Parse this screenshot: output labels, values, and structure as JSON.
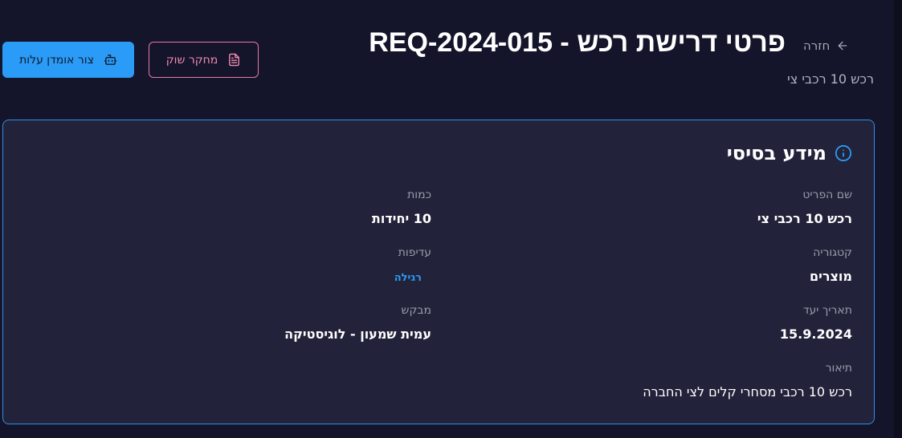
{
  "header": {
    "back_label": "חזרה",
    "title": "פרטי דרישת רכש - REQ-2024-015",
    "subtitle": "רכש 10 רכבי צי"
  },
  "actions": {
    "market_research_label": "מחקר שוק",
    "create_estimator_label": "צור אומדן עלות"
  },
  "card": {
    "title": "מידע בסיסי",
    "fields": {
      "item_name": {
        "label": "שם הפריט",
        "value": "רכש 10 רכבי צי"
      },
      "quantity": {
        "label": "כמות",
        "value": "10 יחידות"
      },
      "category": {
        "label": "קטגוריה",
        "value": "מוצרים"
      },
      "priority": {
        "label": "עדיפות",
        "value": "רגילה"
      },
      "target_date": {
        "label": "תאריך יעד",
        "value": "15.9.2024"
      },
      "requester": {
        "label": "מבקש",
        "value": "עמית שמעון - לוגיסטיקה"
      },
      "description": {
        "label": "תיאור",
        "value": "רכש 10 רכבי מסחרי קלים לצי החברה"
      }
    }
  },
  "colors": {
    "background": "#14142a",
    "card_bg": "#22223a",
    "accent_blue": "#2a9bf7",
    "accent_pink": "#f08bb2",
    "muted_text": "#9a9bab"
  }
}
